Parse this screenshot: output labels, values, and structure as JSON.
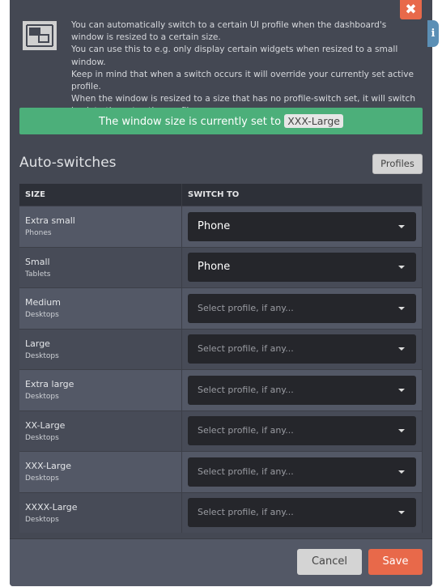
{
  "intro": {
    "lines": [
      "You can automatically switch to a certain UI profile when the dashboard's window is resized to a certain size.",
      "You can use this to e.g. only display certain widgets when resized to a small window.",
      "Keep in mind that when a switch occurs it will override your currently set active profile.",
      "When the window is resized to a size that has no profile-switch set, it will switch back to the set active profile."
    ]
  },
  "banner": {
    "text": "The window size is currently set to",
    "current_size": "XXX-Large",
    "color": "#4caf7a"
  },
  "section": {
    "title": "Auto-switches",
    "profiles_label": "Profiles"
  },
  "table": {
    "headers": [
      "SIZE",
      "SWITCH TO"
    ],
    "placeholder": "Select profile, if any...",
    "rows": [
      {
        "size": "Extra small",
        "device": "Phones",
        "value": "Phone"
      },
      {
        "size": "Small",
        "device": "Tablets",
        "value": "Phone"
      },
      {
        "size": "Medium",
        "device": "Desktops",
        "value": ""
      },
      {
        "size": "Large",
        "device": "Desktops",
        "value": ""
      },
      {
        "size": "Extra large",
        "device": "Desktops",
        "value": ""
      },
      {
        "size": "XX-Large",
        "device": "Desktops",
        "value": ""
      },
      {
        "size": "XXX-Large",
        "device": "Desktops",
        "value": ""
      },
      {
        "size": "XXXX-Large",
        "device": "Desktops",
        "value": ""
      }
    ]
  },
  "footer": {
    "cancel_label": "Cancel",
    "save_label": "Save",
    "accent": "#e8694a"
  },
  "icons": {
    "close": "close-icon",
    "info": "info-icon",
    "resize": "resize-icon"
  }
}
